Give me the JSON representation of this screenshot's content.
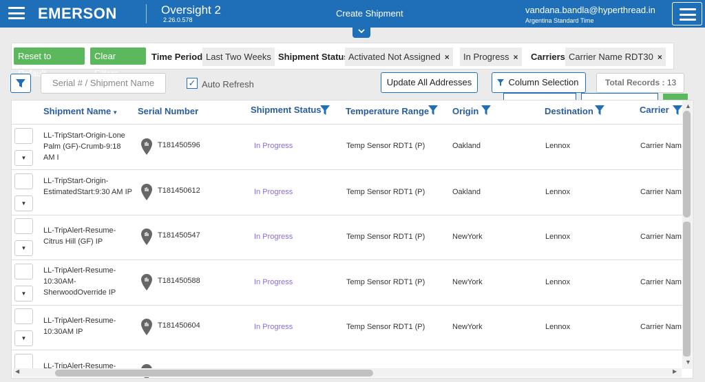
{
  "header": {
    "brand": "EMERSON",
    "app_name": "Oversight 2",
    "app_version": "2.26.0.578",
    "create_shipment": "Create Shipment",
    "user_email": "vandana.bandla@hyperthread.in",
    "user_timezone": "Argentina Standard Time",
    "collapse_icon": "chevron-down-icon"
  },
  "filters": {
    "reset_label": "Reset to Default",
    "clear_label": "Clear Filters",
    "time_period_label": "Time Period",
    "time_period_value": "Last Two Weeks",
    "status_label": "Shipment Status",
    "status_values": [
      "Activated Not Assigned",
      "In Progress"
    ],
    "carriers_label": "Carriers",
    "carrier_value": "Carrier Name RDT30",
    "remove_glyph": "×"
  },
  "toolbar": {
    "search_placeholder": "Serial # / Shipment Name",
    "auto_refresh_label": "Auto Refresh",
    "auto_refresh_checked": "✓",
    "update_addresses_label": "Update All Addresses",
    "column_selection_label": "Column Selection",
    "total_records_label": "Total Records :",
    "total_records_value": "13"
  },
  "grid": {
    "columns": [
      "Shipment Name",
      "Serial Number",
      "Shipment Status",
      "Temperature Range",
      "Origin",
      "Destination",
      "Carrier"
    ],
    "rows": [
      {
        "name": "LL-TripStart-Origin-Lone Palm (GF)-Crumb-9:18 AM I",
        "serial": "T181450596",
        "status": "In Progress",
        "temp": "Temp Sensor RDT1 (P)",
        "origin": "Oakland",
        "destination": "Lennox",
        "carrier": "Carrier Nam"
      },
      {
        "name": "LL-TripStart-Origin-EstimatedStart:9:30 AM IP",
        "serial": "T181450612",
        "status": "In Progress",
        "temp": "Temp Sensor RDT1 (P)",
        "origin": "Oakland",
        "destination": "Lennox",
        "carrier": "Carrier Nam"
      },
      {
        "name": "LL-TripAlert-Resume-Citrus Hill (GF) IP",
        "serial": "T181450547",
        "status": "In Progress",
        "temp": "Temp Sensor RDT1 (P)",
        "origin": "NewYork",
        "destination": "Lennox",
        "carrier": "Carrier Nam"
      },
      {
        "name": "LL-TripAlert-Resume-10:30AM-SherwoodOverride IP",
        "serial": "T181450588",
        "status": "In Progress",
        "temp": "Temp Sensor RDT1 (P)",
        "origin": "NewYork",
        "destination": "Lennox",
        "carrier": "Carrier Nam"
      },
      {
        "name": "LL-TripAlert-Resume-10:30AM IP",
        "serial": "T181450604",
        "status": "In Progress",
        "temp": "Temp Sensor RDT1 (P)",
        "origin": "NewYork",
        "destination": "Lennox",
        "carrier": "Carrier Nam"
      },
      {
        "name": "LL-TripAlert-Resume-",
        "serial": "",
        "status": "",
        "temp": "",
        "origin": "",
        "destination": "",
        "carrier": ""
      }
    ]
  },
  "colors": {
    "header_bg": "#1f6fb8",
    "green": "#5cb85c",
    "status_purple": "#8b6bd9",
    "column_header": "#2a5d9f"
  }
}
